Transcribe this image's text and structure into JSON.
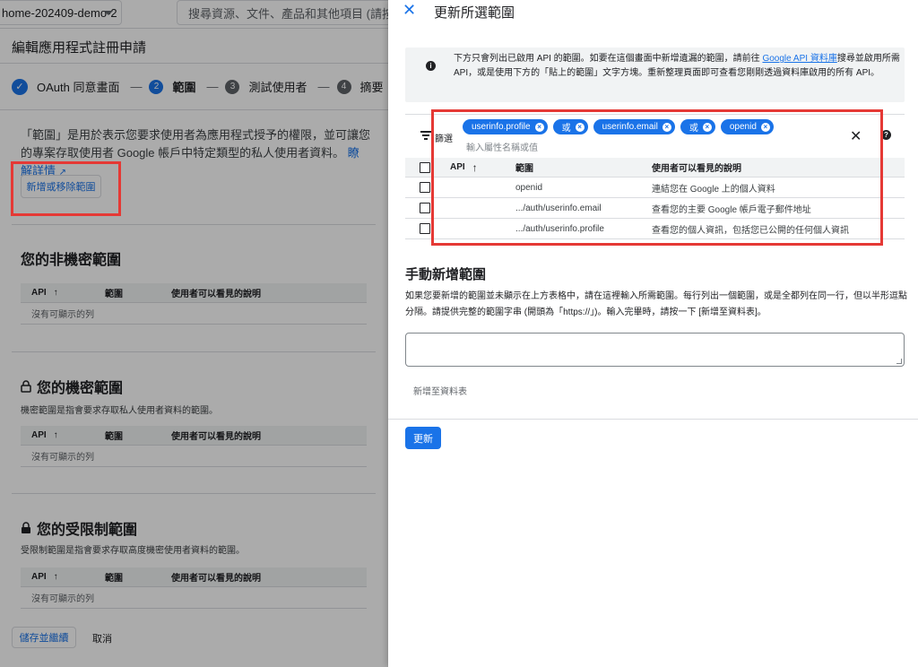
{
  "topbar": {
    "project": "home-202409-demo-2",
    "search_placeholder": "搜尋資源、文件、產品和其他項目 (請按 / 鍵"
  },
  "page": {
    "title": "編輯應用程式註冊申請",
    "steps": [
      {
        "label": "OAuth 同意畫面",
        "number": "✓"
      },
      {
        "label": "範圍",
        "number": "2"
      },
      {
        "label": "測試使用者",
        "number": "3"
      },
      {
        "label": "摘要",
        "number": "4"
      }
    ],
    "step_separator": "—",
    "intro_text": "「範圍」是用於表示您要求使用者為應用程式授予的權限，並可讓您的專案存取使用者 Google 帳戶中特定類型的私人使用者資料。",
    "learn_more": "瞭解詳情",
    "add_remove_button": "新增或移除範圍"
  },
  "sections": {
    "non_sensitive": {
      "title": "您的非機密範圍",
      "desc": ""
    },
    "sensitive": {
      "title": "您的機密範圍",
      "desc": "機密範圍是指會要求存取私人使用者資料的範圍。"
    },
    "restricted": {
      "title": "您的受限制範圍",
      "desc": "受限制範圍是指會要求存取高度機密使用者資料的範圍。"
    },
    "table_headers": {
      "api": "API",
      "scope": "範圍",
      "desc": "使用者可以看見的說明"
    },
    "empty_row": "沒有可顯示的列"
  },
  "footer": {
    "save_button": "儲存並繼續",
    "cancel_button": "取消"
  },
  "panel": {
    "title": "更新所選範圍",
    "info_prefix": "下方只會列出已啟用 API 的範圍。如要在這個畫面中新增遺漏的範圍，請前往 ",
    "info_link": "Google API 資料庫",
    "info_suffix": "搜尋並啟用所需 API，或是使用下方的「貼上的範圍」文字方塊。重新整理頁面即可查看您剛剛透過資料庫啟用的所有 API。",
    "filter_label": "篩選",
    "chips": [
      "userinfo.profile",
      "或",
      "userinfo.email",
      "或",
      "openid"
    ],
    "filter_placeholder": "輸入屬性名稱或值",
    "table_headers": {
      "api": "API",
      "scope": "範圍",
      "desc": "使用者可以看見的說明"
    },
    "rows": [
      {
        "api": "",
        "scope": "openid",
        "desc": "連結您在 Google 上的個人資料"
      },
      {
        "api": "",
        "scope": ".../auth/userinfo.email",
        "desc": "查看您的主要 Google 帳戶電子郵件地址"
      },
      {
        "api": "",
        "scope": ".../auth/userinfo.profile",
        "desc": "查看您的個人資訊，包括您已公開的任何個人資訊"
      }
    ],
    "manual_title": "手動新增範圍",
    "manual_desc": "如果您要新增的範圍並未顯示在上方表格中，請在這裡輸入所需範圍。每行列出一個範圍，或是全都列在同一行，但以半形逗點分隔。請提供完整的範圍字串 (開頭為「https://」)。輸入完畢時，請按一下 [新增至資料表]。",
    "add_to_table": "新增至資料表",
    "update_button": "更新"
  },
  "colors": {
    "accent": "#1a73e8",
    "highlight": "#e53935"
  }
}
